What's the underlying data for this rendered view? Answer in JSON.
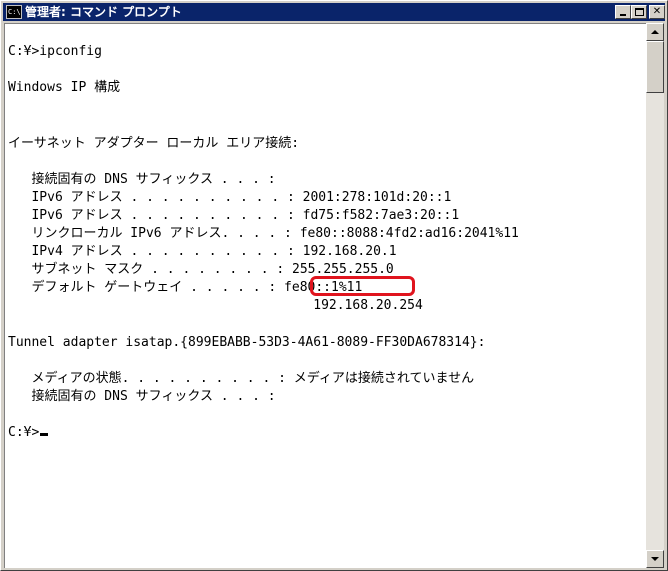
{
  "window": {
    "title": "管理者: コマンド プロンプト",
    "icon_text": "C:\\",
    "icon": "cmd-icon"
  },
  "titlebar_buttons": {
    "minimize": "minimize-icon",
    "maximize": "maximize-icon",
    "close": "close-icon",
    "close_glyph": "✕"
  },
  "console": {
    "lines": [
      "C:¥>ipconfig",
      "Windows IP 構成",
      "イーサネット アダプター ローカル エリア接続:",
      "   接続固有の DNS サフィックス . . . :",
      "   IPv6 アドレス . . . . . . . . . . : 2001:278:101d:20::1",
      "   IPv6 アドレス . . . . . . . . . . : fd75:f582:7ae3:20::1",
      "   リンクローカル IPv6 アドレス. . . . : fe80::8088:4fd2:ad16:2041%11",
      "   IPv4 アドレス . . . . . . . . . . : 192.168.20.1",
      "   サブネット マスク . . . . . . . . : 255.255.255.0",
      "   デフォルト ゲートウェイ . . . . . : fe80::1%11",
      "                                       192.168.20.254",
      "Tunnel adapter isatap.{899EBABB-53D3-4A61-8089-FF30DA678314}:",
      "   メディアの状態. . . . . . . . . . : メディアは接続されていません",
      "   接続固有の DNS サフィックス . . . :",
      "C:¥>"
    ]
  },
  "annotation": {
    "highlight_color": "#e0141e",
    "target_text": "fe80::1%11"
  },
  "colors": {
    "titlebar": "#0a246a",
    "console_bg": "#ffffff",
    "console_text": "#000000"
  }
}
